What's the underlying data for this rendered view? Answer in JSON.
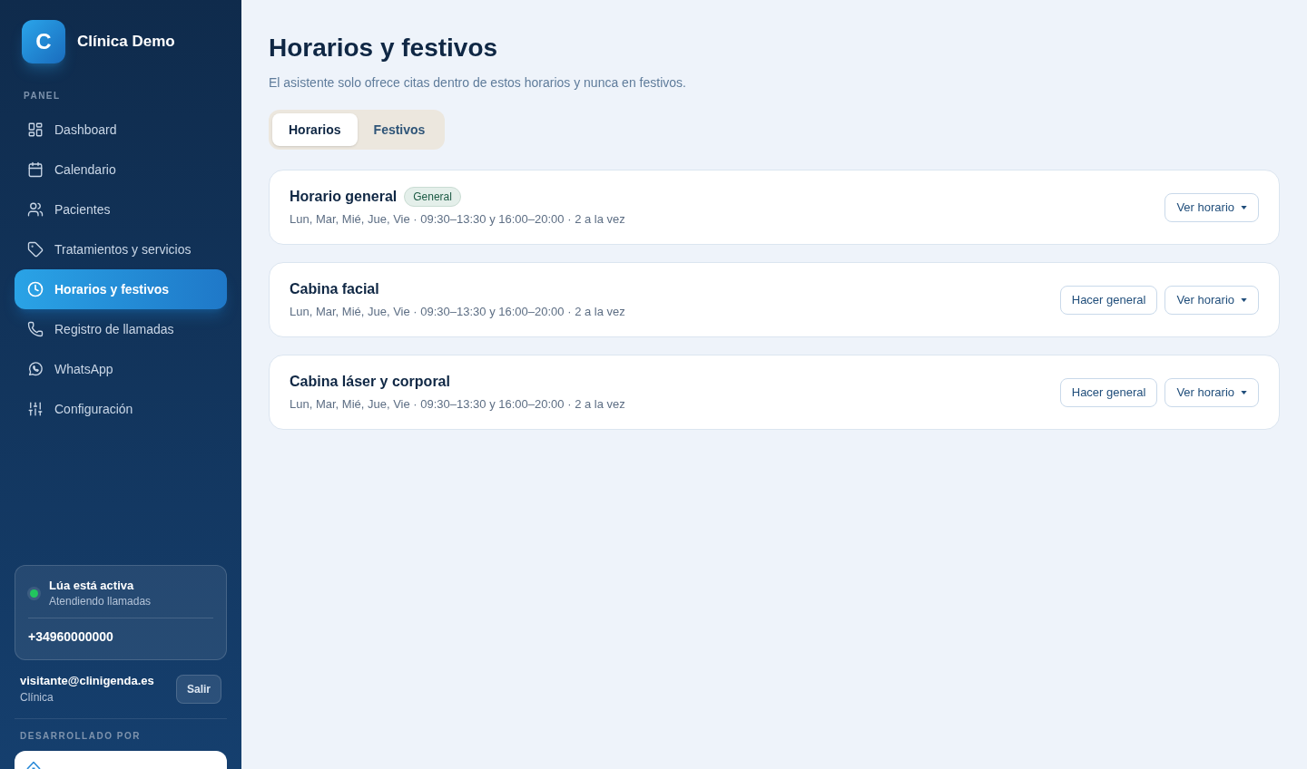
{
  "sidebar": {
    "brand": {
      "logo_letter": "C",
      "name": "Clínica Demo"
    },
    "section_label": "PANEL",
    "items": [
      {
        "label": "Dashboard",
        "selected": false
      },
      {
        "label": "Calendario",
        "selected": false
      },
      {
        "label": "Pacientes",
        "selected": false
      },
      {
        "label": "Tratamientos y servicios",
        "selected": false
      },
      {
        "label": "Horarios y festivos",
        "selected": true
      },
      {
        "label": "Registro de llamadas",
        "selected": false
      },
      {
        "label": "WhatsApp",
        "selected": false
      },
      {
        "label": "Configuración",
        "selected": false
      }
    ],
    "status_card": {
      "title": "Lúa está activa",
      "subtitle": "Atendiendo llamadas",
      "active": true,
      "phone": "+34960000000"
    },
    "user": {
      "email": "visitante@clinigenda.es",
      "role": "Clínica",
      "logout_button": "Salir"
    },
    "credit_label": "DESARROLLADO POR"
  },
  "page": {
    "title": "Horarios y festivos",
    "subtitle": "El asistente solo ofrece citas dentro de estos horarios y nunca en festivos."
  },
  "tabs": [
    {
      "label": "Horarios",
      "selected": true
    },
    {
      "label": "Festivos",
      "selected": false
    }
  ],
  "schedules": [
    {
      "name": "Horario general",
      "badge": "General",
      "summary": "Lun, Mar, Mié, Jue, Vie · 09:30–13:30 y 16:00–20:00 · 2 a la vez",
      "actions": [
        {
          "label": "Ver horario",
          "kind": "dropdown"
        }
      ]
    },
    {
      "name": "Cabina facial",
      "summary": "Lun, Mar, Mié, Jue, Vie · 09:30–13:30 y 16:00–20:00 · 2 a la vez",
      "actions": [
        {
          "label": "Hacer general",
          "kind": "plain"
        },
        {
          "label": "Ver horario",
          "kind": "dropdown"
        }
      ]
    },
    {
      "name": "Cabina láser y corporal",
      "summary": "Lun, Mar, Mié, Jue, Vie · 09:30–13:30 y 16:00–20:00 · 2 a la vez",
      "actions": [
        {
          "label": "Hacer general",
          "kind": "plain"
        },
        {
          "label": "Ver horario",
          "kind": "dropdown"
        }
      ]
    }
  ]
}
